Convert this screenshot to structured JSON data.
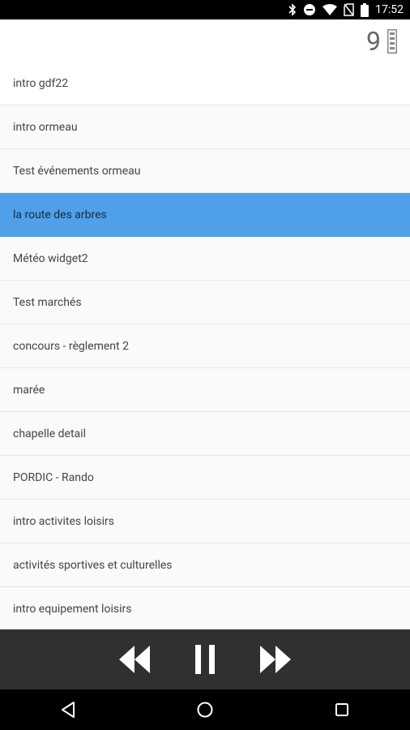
{
  "status_bar": {
    "time": "17:52",
    "icons": [
      "bluetooth-icon",
      "dnd-icon",
      "wifi-icon",
      "no-sim-icon",
      "battery-icon"
    ]
  },
  "header": {
    "counter": "9",
    "counter_icon": "stack-icon"
  },
  "list": {
    "items": [
      {
        "label": "intro gdf22",
        "selected": false
      },
      {
        "label": "intro ormeau",
        "selected": false
      },
      {
        "label": "Test événements ormeau",
        "selected": false
      },
      {
        "label": "la route des arbres",
        "selected": true
      },
      {
        "label": "Météo widget2",
        "selected": false
      },
      {
        "label": "Test marchés",
        "selected": false
      },
      {
        "label": "concours - règlement 2",
        "selected": false
      },
      {
        "label": "marée",
        "selected": false
      },
      {
        "label": "chapelle detail",
        "selected": false
      },
      {
        "label": "PORDIC - Rando",
        "selected": false
      },
      {
        "label": "intro activites loisirs",
        "selected": false
      },
      {
        "label": "activités sportives et culturelles",
        "selected": false
      },
      {
        "label": "intro equipement loisirs",
        "selected": false
      }
    ]
  },
  "player": {
    "buttons": [
      "rewind-icon",
      "pause-icon",
      "fast-forward-icon"
    ]
  },
  "navbar": {
    "buttons": [
      "back-icon",
      "home-icon",
      "recents-icon"
    ]
  },
  "colors": {
    "selected_row": "#4fa0e9",
    "player_bg": "#303030",
    "status_bg": "#000000"
  }
}
